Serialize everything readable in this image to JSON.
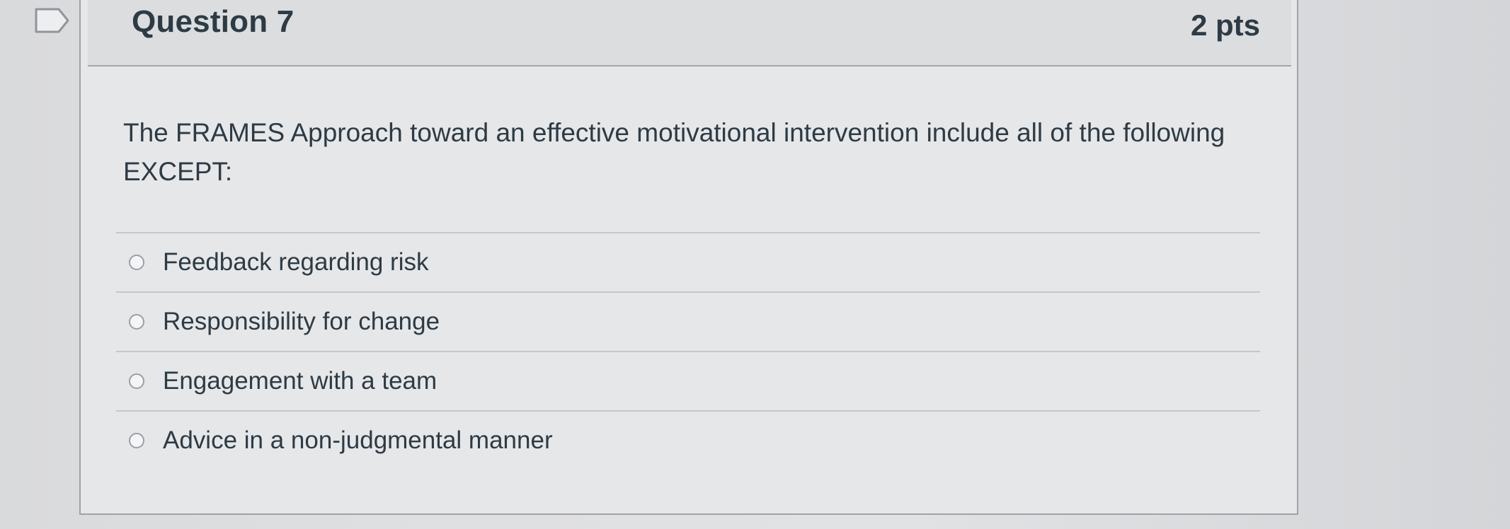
{
  "question": {
    "title": "Question 7",
    "points": "2 pts",
    "text": "The FRAMES Approach toward an effective motivational intervention include all of the following EXCEPT:"
  },
  "answers": [
    {
      "label": "Feedback regarding risk"
    },
    {
      "label": "Responsibility for change"
    },
    {
      "label": "Engagement with a team"
    },
    {
      "label": "Advice in a non-judgmental manner"
    }
  ],
  "colors": {
    "text": "#2d3b45",
    "header_bg": "#dcdddf",
    "card_bg": "#e6e7e9"
  },
  "icons": {
    "flag": "flag-question-icon",
    "radio": "radio-button-icon"
  }
}
